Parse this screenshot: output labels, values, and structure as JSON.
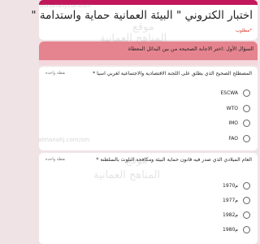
{
  "form": {
    "title": "اختبار الكتروني \" البيئة العمانية حماية واستدامة \"",
    "required_note": "*مطلوب"
  },
  "section": {
    "title": "السؤال الأول :اختر الاجابة الصحيحة من بين البدائل المعطاة"
  },
  "questions": [
    {
      "text": "المصطلح الصحيح الذي يطلق على اللجنة الاقتصادية والاجتماعية لغربي اسيا *",
      "points": "نقطة واحدة",
      "options": [
        "ESCWA",
        "WTO",
        "IMO",
        "FAO"
      ]
    },
    {
      "text": "العام الميلادي الذي صدر فيه قانون حماية البيئة ومكافحة التلوث بالسلطنة *",
      "points": "نقطة واحدة",
      "options": [
        "1970م",
        "1977م",
        "1982م",
        "1980م"
      ]
    }
  ],
  "watermark": {
    "url": "almanahj.com/om",
    "arabic": "موقع",
    "arabic2": "المناهج العمانية"
  }
}
